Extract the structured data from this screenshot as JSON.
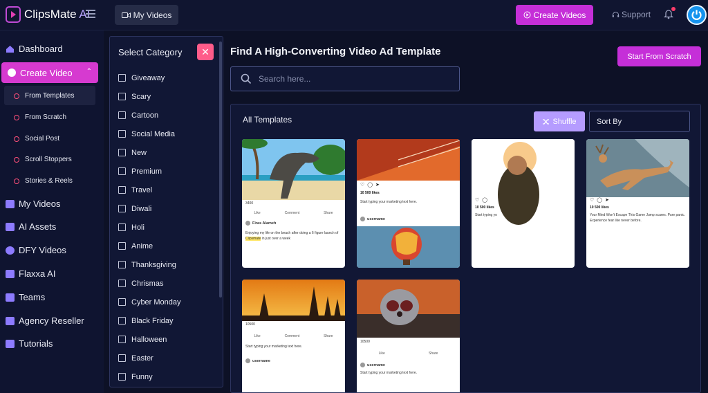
{
  "app": {
    "name": "ClipsMate",
    "name_suffix": "AI"
  },
  "header": {
    "my_videos_label": "My Videos",
    "create_videos_label": "Create Videos",
    "support_label": "Support"
  },
  "sidebar": {
    "dashboard": "Dashboard",
    "create_video": "Create Video",
    "sub_items": [
      "From Templates",
      "From Scratch",
      "Social Post",
      "Scroll Stoppers",
      "Stories & Reels"
    ],
    "my_videos": "My Videos",
    "ai_assets": "AI Assets",
    "dfy_videos": "DFY Videos",
    "flaxxa_ai": "Flaxxa AI",
    "teams": "Teams",
    "agency_reseller": "Agency Reseller",
    "tutorials": "Tutorials"
  },
  "category_panel": {
    "title": "Select Category",
    "close_label": "✕",
    "items": [
      "Giveaway",
      "Scary",
      "Cartoon",
      "Social Media",
      "New",
      "Premium",
      "Travel",
      "Diwali",
      "Holi",
      "Anime",
      "Thanksgiving",
      "Chrismas",
      "Cyber Monday",
      "Black Friday",
      "Halloween",
      "Easter",
      "Funny"
    ]
  },
  "main": {
    "title": "Find A High-Converting Video Ad Template",
    "start_from_scratch": "Start From Scratch",
    "search_placeholder": "Search here...",
    "all_templates": "All Templates",
    "shuffle_label": "Shuffle",
    "sort_by": "Sort By"
  },
  "cards": {
    "c1": {
      "reactions": "3400",
      "like": "Like",
      "comment": "Comment",
      "share": "Share",
      "user": "Firas Alameh",
      "caption_pre": "Enjoying my life on the beach after doing a 6 figure launch of",
      "caption_hl": "Clipsmate",
      "caption_post": "in just over a week"
    },
    "c2": {
      "likes": "10 500 likes",
      "caption": "Start typing your marketing text here.",
      "user": "username"
    },
    "c3": {
      "likes": "10 500 likes",
      "caption": "Start typing yo"
    },
    "c4": {
      "likes": "10 500 likes",
      "caption": "Your Mind Won't Escape This Game Jump scares. Pure panic. Experience fear like never before."
    },
    "c5": {
      "reactions": "10500",
      "like": "Like",
      "comment": "Comment",
      "share": "Share",
      "caption": "Start typing your marketing text here.",
      "user": "username"
    },
    "c6": {
      "reactions": "10500",
      "like": "Like",
      "share": "Share",
      "caption": "Start typing your marketing text here.",
      "user": "username"
    }
  },
  "colors": {
    "accent": "#c52fd8",
    "sidebar_active": "#d63ad0",
    "shuffle": "#b59cff",
    "close": "#ff5c8a",
    "background": "#0d1126"
  }
}
